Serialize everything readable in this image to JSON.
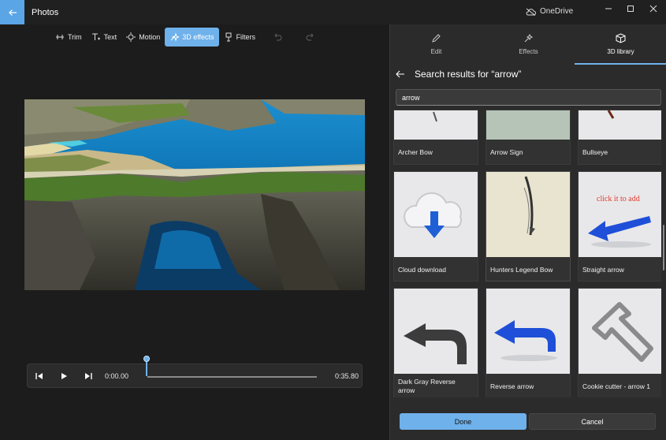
{
  "app": {
    "title": "Photos",
    "onedrive": "OneDrive"
  },
  "toolbar": {
    "trim": "Trim",
    "text": "Text",
    "motion": "Motion",
    "effects3d": "3D effects",
    "filters": "Filters"
  },
  "player": {
    "current_time": "0:00.00",
    "total_time": "0:35.80",
    "progress": 0
  },
  "panel": {
    "tabs": [
      {
        "label": "Edit",
        "icon": "pencil-icon"
      },
      {
        "label": "Effects",
        "icon": "sparkle-icon"
      },
      {
        "label": "3D library",
        "icon": "cube-icon"
      }
    ],
    "results_title": "Search results for “arrow”",
    "search_value": "arrow",
    "items": [
      {
        "label": "Archer Bow"
      },
      {
        "label": "Arrow Sign"
      },
      {
        "label": "Bullseye"
      },
      {
        "label": "Cloud download"
      },
      {
        "label": "Hunters Legend Bow"
      },
      {
        "label": "Straight arrow"
      },
      {
        "label": "Dark Gray Reverse arrow"
      },
      {
        "label": "Reverse arrow"
      },
      {
        "label": "Cookie cutter - arrow 1"
      }
    ],
    "annotation": "click it to add",
    "done_label": "Done",
    "cancel_label": "Cancel"
  },
  "colors": {
    "accent": "#6fb1eb",
    "annotation": "#e33b2e"
  }
}
